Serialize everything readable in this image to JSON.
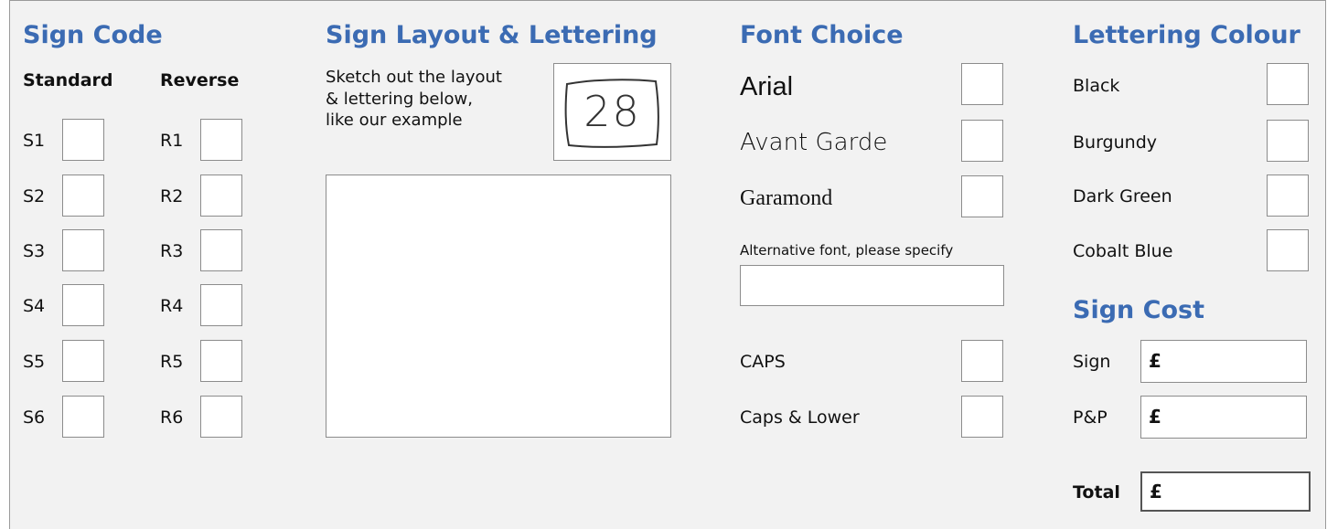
{
  "sign_code": {
    "heading": "Sign Code",
    "standard_label": "Standard",
    "reverse_label": "Reverse",
    "standard": [
      "S1",
      "S2",
      "S3",
      "S4",
      "S5",
      "S6"
    ],
    "reverse": [
      "R1",
      "R2",
      "R3",
      "R4",
      "R5",
      "R6"
    ]
  },
  "layout": {
    "heading": "Sign Layout & Lettering",
    "instructions_line1": "Sketch out the layout",
    "instructions_line2": "& lettering below,",
    "instructions_line3": "like our example",
    "example_number": "28"
  },
  "font_choice": {
    "heading": "Font Choice",
    "fonts": [
      "Arial",
      "Avant Garde",
      "Garamond"
    ],
    "alternative_label": "Alternative font, please specify",
    "case_options": [
      "CAPS",
      "Caps & Lower"
    ]
  },
  "lettering_colour": {
    "heading": "Lettering Colour",
    "options": [
      "Black",
      "Burgundy",
      "Dark Green",
      "Cobalt Blue"
    ]
  },
  "sign_cost": {
    "heading": "Sign Cost",
    "sign_label": "Sign",
    "pp_label": "P&P",
    "total_label": "Total",
    "currency": "£"
  },
  "colors": {
    "heading": "#3b6bb3",
    "panel_bg": "#f2f2f2",
    "box_border": "#8c8c8c"
  }
}
